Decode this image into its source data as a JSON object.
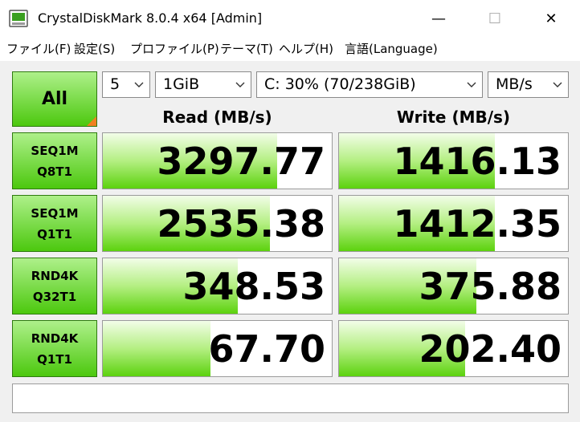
{
  "window": {
    "title": "CrystalDiskMark 8.0.4 x64 [Admin]",
    "minimize_glyph": "—",
    "maximize_glyph": "☐",
    "close_glyph": "✕",
    "icon": "crystaldiskmark-app-icon"
  },
  "menu": [
    {
      "label": "ファイル(F)"
    },
    {
      "label": "設定(S)"
    },
    {
      "label": "プロファイル(P)"
    },
    {
      "label": "テーマ(T)"
    },
    {
      "label": "ヘルプ(H)"
    },
    {
      "label": "言語(Language)"
    }
  ],
  "controls": {
    "all_label": "All",
    "count": "5",
    "size": "1GiB",
    "drive": "C: 30% (70/238GiB)",
    "unit": "MB/s"
  },
  "headers": {
    "read": "Read (MB/s)",
    "write": "Write (MB/s)"
  },
  "tests": [
    {
      "line1": "SEQ1M",
      "line2": "Q8T1",
      "read": "3297.77",
      "write": "1416.13",
      "read_fill": 0.76,
      "write_fill": 0.68
    },
    {
      "line1": "SEQ1M",
      "line2": "Q1T1",
      "read": "2535.38",
      "write": "1412.35",
      "read_fill": 0.73,
      "write_fill": 0.68
    },
    {
      "line1": "RND4K",
      "line2": "Q32T1",
      "read": "348.53",
      "write": "375.88",
      "read_fill": 0.59,
      "write_fill": 0.6
    },
    {
      "line1": "RND4K",
      "line2": "Q1T1",
      "read": "67.70",
      "write": "202.40",
      "read_fill": 0.47,
      "write_fill": 0.55
    }
  ],
  "status": "",
  "colors": {
    "accent_green": "#4cc80e",
    "corner_orange": "#f08020"
  }
}
